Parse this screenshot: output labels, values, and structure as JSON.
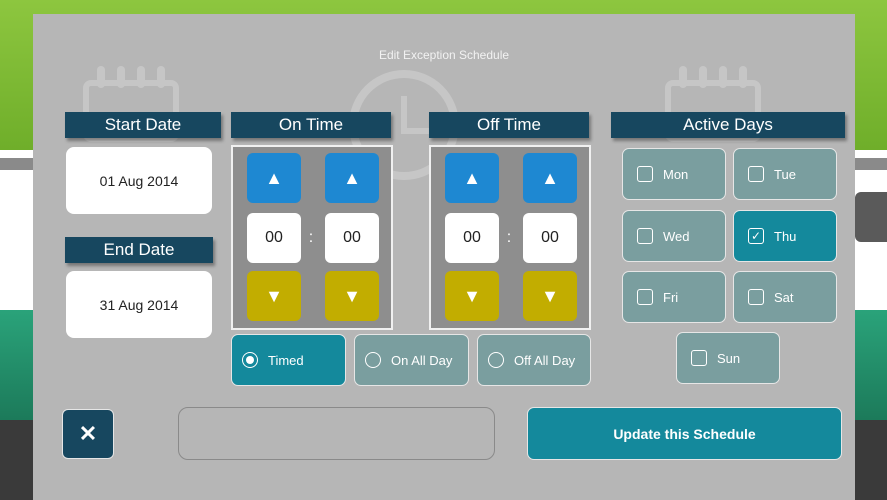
{
  "modal": {
    "title": "Edit Exception Schedule"
  },
  "start_date": {
    "label": "Start Date",
    "value": "01 Aug 2014"
  },
  "end_date": {
    "label": "End Date",
    "value": "31 Aug 2014"
  },
  "on_time": {
    "label": "On Time",
    "hours": "00",
    "minutes": "00",
    "separator": ":"
  },
  "off_time": {
    "label": "Off Time",
    "hours": "00",
    "minutes": "00",
    "separator": ":"
  },
  "arrows": {
    "up": "▲",
    "down": "▼"
  },
  "modes": [
    {
      "label": "Timed",
      "selected": true
    },
    {
      "label": "On All Day",
      "selected": false
    },
    {
      "label": "Off All Day",
      "selected": false
    }
  ],
  "active_days": {
    "label": "Active Days",
    "days": [
      {
        "label": "Mon",
        "checked": false
      },
      {
        "label": "Tue",
        "checked": false
      },
      {
        "label": "Wed",
        "checked": false
      },
      {
        "label": "Thu",
        "checked": true
      },
      {
        "label": "Fri",
        "checked": false
      },
      {
        "label": "Sat",
        "checked": false
      },
      {
        "label": "Sun",
        "checked": false
      }
    ],
    "check_mark": "✓"
  },
  "actions": {
    "close_label": "✕",
    "update_label": "Update this Schedule",
    "message_value": ""
  },
  "colors": {
    "ribbon": "#17475f",
    "up_button": "#1e88d2",
    "down_button": "#c2ad00",
    "selected": "#14899c",
    "unselected": "#7a9e9f",
    "modal_bg": "#b6b6b6"
  }
}
